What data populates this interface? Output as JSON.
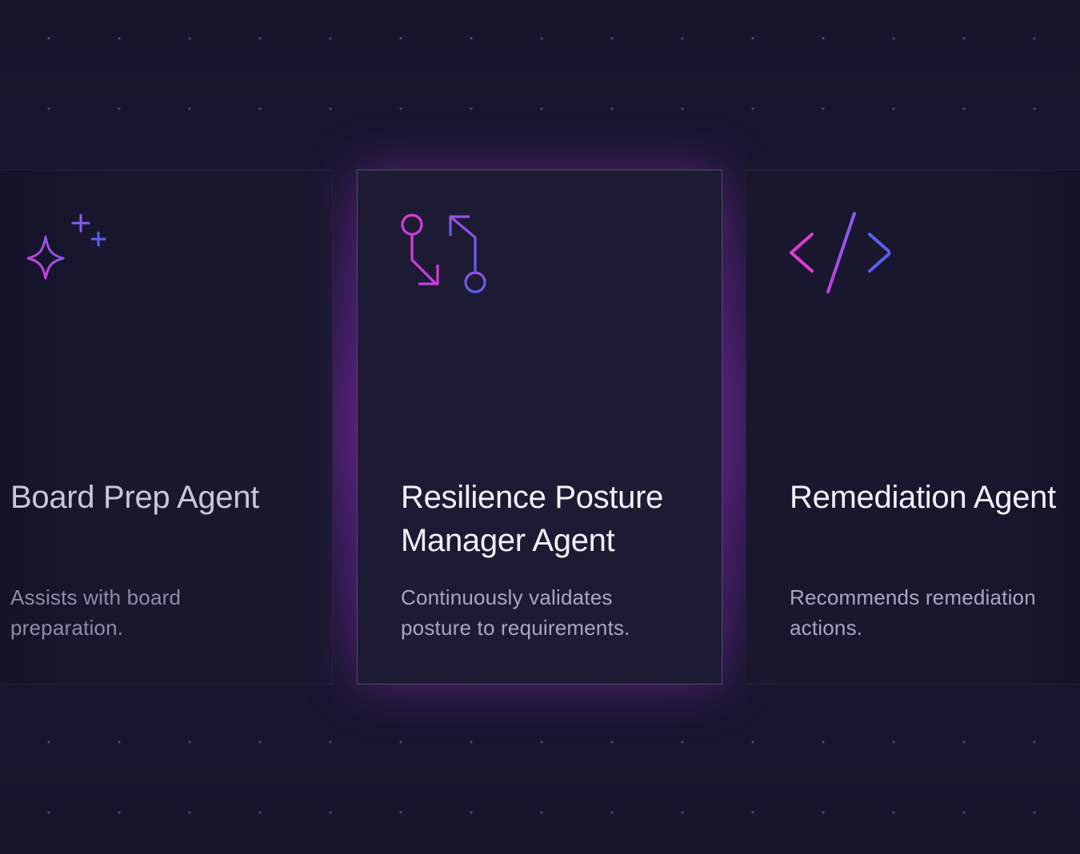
{
  "cards": [
    {
      "title": "Board Prep Agent",
      "description": "Assists with board preparation.",
      "icon": "sparkle-icon"
    },
    {
      "title": "Resilience Posture Manager Agent",
      "description": "Continuously validates posture to requirements.",
      "icon": "git-compare-icon"
    },
    {
      "title": "Remediation Agent",
      "description": "Recommends remediation actions.",
      "icon": "code-icon"
    }
  ],
  "colors": {
    "background": "#151329",
    "card": "#1c1b33",
    "glow": "#a828c8",
    "accent_pink": "#e23bd3",
    "accent_purple": "#a24fe3",
    "accent_blue": "#5b5ef0"
  }
}
